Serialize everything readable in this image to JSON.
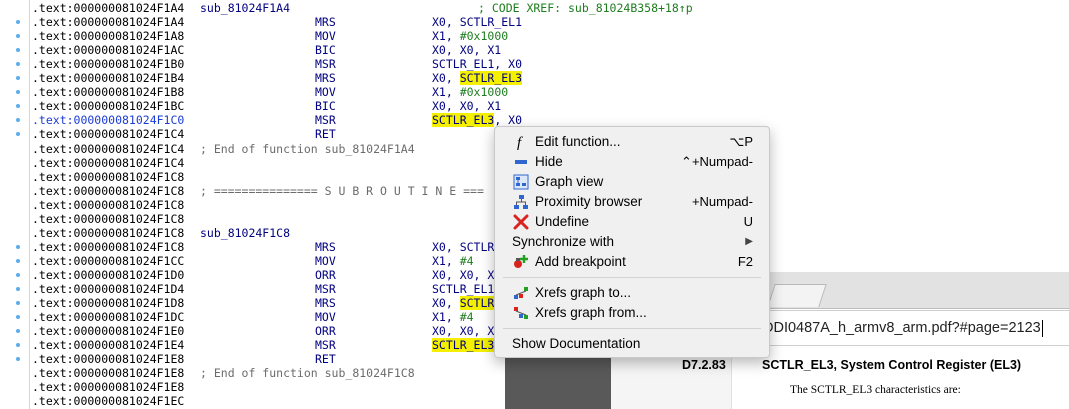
{
  "listing": {
    "lines": [
      {
        "addr": ".text:000000081024F1A4",
        "label": "sub_81024F1A4",
        "xref": "; CODE XREF: sub_81024B358+18↑p"
      },
      {
        "addr": ".text:000000081024F1A4",
        "mnemonic": "MRS",
        "operands": "X0, SCTLR_EL1"
      },
      {
        "addr": ".text:000000081024F1A8",
        "mnemonic": "MOV",
        "operands": "X1, #0x1000"
      },
      {
        "addr": ".text:000000081024F1AC",
        "mnemonic": "BIC",
        "operands": "X0, X0, X1"
      },
      {
        "addr": ".text:000000081024F1B0",
        "mnemonic": "MSR",
        "operands": "SCTLR_EL1, X0"
      },
      {
        "addr": ".text:000000081024F1B4",
        "mnemonic": "MRS",
        "operands_pre": "X0, ",
        "operands_hl": "SCTLR_EL3",
        "operands_post": ""
      },
      {
        "addr": ".text:000000081024F1B8",
        "mnemonic": "MOV",
        "operands": "X1, #0x1000"
      },
      {
        "addr": ".text:000000081024F1BC",
        "mnemonic": "BIC",
        "operands": "X0, X0, X1"
      },
      {
        "addr": ".text:000000081024F1C0",
        "mnemonic": "MSR",
        "operands_pre": "",
        "operands_hl": "SCTLR_EL3",
        "operands_post": ", X0",
        "current": true
      },
      {
        "addr": ".text:000000081024F1C4",
        "mnemonic": "RET"
      },
      {
        "addr": ".text:000000081024F1C4",
        "comment": "; End of function sub_81024F1A4"
      },
      {
        "addr": ".text:000000081024F1C4"
      },
      {
        "addr": ".text:000000081024F1C8"
      },
      {
        "addr": ".text:000000081024F1C8",
        "comment": "; =============== S U B R O U T I N E ==="
      },
      {
        "addr": ".text:000000081024F1C8"
      },
      {
        "addr": ".text:000000081024F1C8"
      },
      {
        "addr": ".text:000000081024F1C8",
        "label": "sub_81024F1C8"
      },
      {
        "addr": ".text:000000081024F1C8",
        "mnemonic": "MRS",
        "operands": "X0, SCTLR"
      },
      {
        "addr": ".text:000000081024F1CC",
        "mnemonic": "MOV",
        "operands": "X1, #4"
      },
      {
        "addr": ".text:000000081024F1D0",
        "mnemonic": "ORR",
        "operands": "X0, X0, X"
      },
      {
        "addr": ".text:000000081024F1D4",
        "mnemonic": "MSR",
        "operands": "SCTLR_EL1"
      },
      {
        "addr": ".text:000000081024F1D8",
        "mnemonic": "MRS",
        "operands_pre": "X0, ",
        "operands_hl": "SCTLR",
        "operands_post": ""
      },
      {
        "addr": ".text:000000081024F1DC",
        "mnemonic": "MOV",
        "operands": "X1, #4"
      },
      {
        "addr": ".text:000000081024F1E0",
        "mnemonic": "ORR",
        "operands": "X0, X0, X"
      },
      {
        "addr": ".text:000000081024F1E4",
        "mnemonic": "MSR",
        "operands_pre": "",
        "operands_hl": "SCTLR_EL3",
        "operands_post": ""
      },
      {
        "addr": ".text:000000081024F1E8",
        "mnemonic": "RET"
      },
      {
        "addr": ".text:000000081024F1E8",
        "comment": "; End of function sub_81024F1C8"
      },
      {
        "addr": ".text:000000081024F1E8"
      },
      {
        "addr": ".text:000000081024F1EC"
      }
    ],
    "dot_rows": [
      1,
      2,
      3,
      4,
      5,
      6,
      7,
      8,
      9,
      17,
      18,
      19,
      20,
      21,
      22,
      23,
      24,
      25
    ]
  },
  "context_menu": {
    "items": [
      {
        "label": "Edit function...",
        "shortcut": "⌥P",
        "icon": "function-icon"
      },
      {
        "label": "Hide",
        "shortcut": "⌃+Numpad-",
        "icon": "hide-icon"
      },
      {
        "label": "Graph view",
        "shortcut": "",
        "icon": "graph-view-icon"
      },
      {
        "label": "Proximity browser",
        "shortcut": "+Numpad-",
        "icon": "proximity-browser-icon"
      },
      {
        "label": "Undefine",
        "shortcut": "U",
        "icon": "undefine-icon"
      },
      {
        "label": "Synchronize with",
        "shortcut": "▶",
        "icon": ""
      },
      {
        "label": "Add breakpoint",
        "shortcut": "F2",
        "icon": "breakpoint-icon"
      },
      {
        "label": "Xrefs graph to...",
        "shortcut": "",
        "icon": "xrefs-graph-to-icon"
      },
      {
        "label": "Xrefs graph from...",
        "shortcut": "",
        "icon": "xrefs-graph-from-icon"
      },
      {
        "label": "Show Documentation",
        "shortcut": "",
        "icon": ""
      }
    ]
  },
  "pdf_viewer": {
    "url": "DDI0487A_h_armv8_arm.pdf?#page=2123",
    "section_number": "D7.2.83",
    "section_title": "SCTLR_EL3, System Control Register (EL3)",
    "body_text": "The SCTLR_EL3 characteristics are:"
  },
  "colors": {
    "highlight": "#f4f000",
    "instruction": "#000080",
    "immediate": "#1e7d1e",
    "current_address": "#1a3bd6",
    "breakpoint_dot": "#5aaeea"
  }
}
